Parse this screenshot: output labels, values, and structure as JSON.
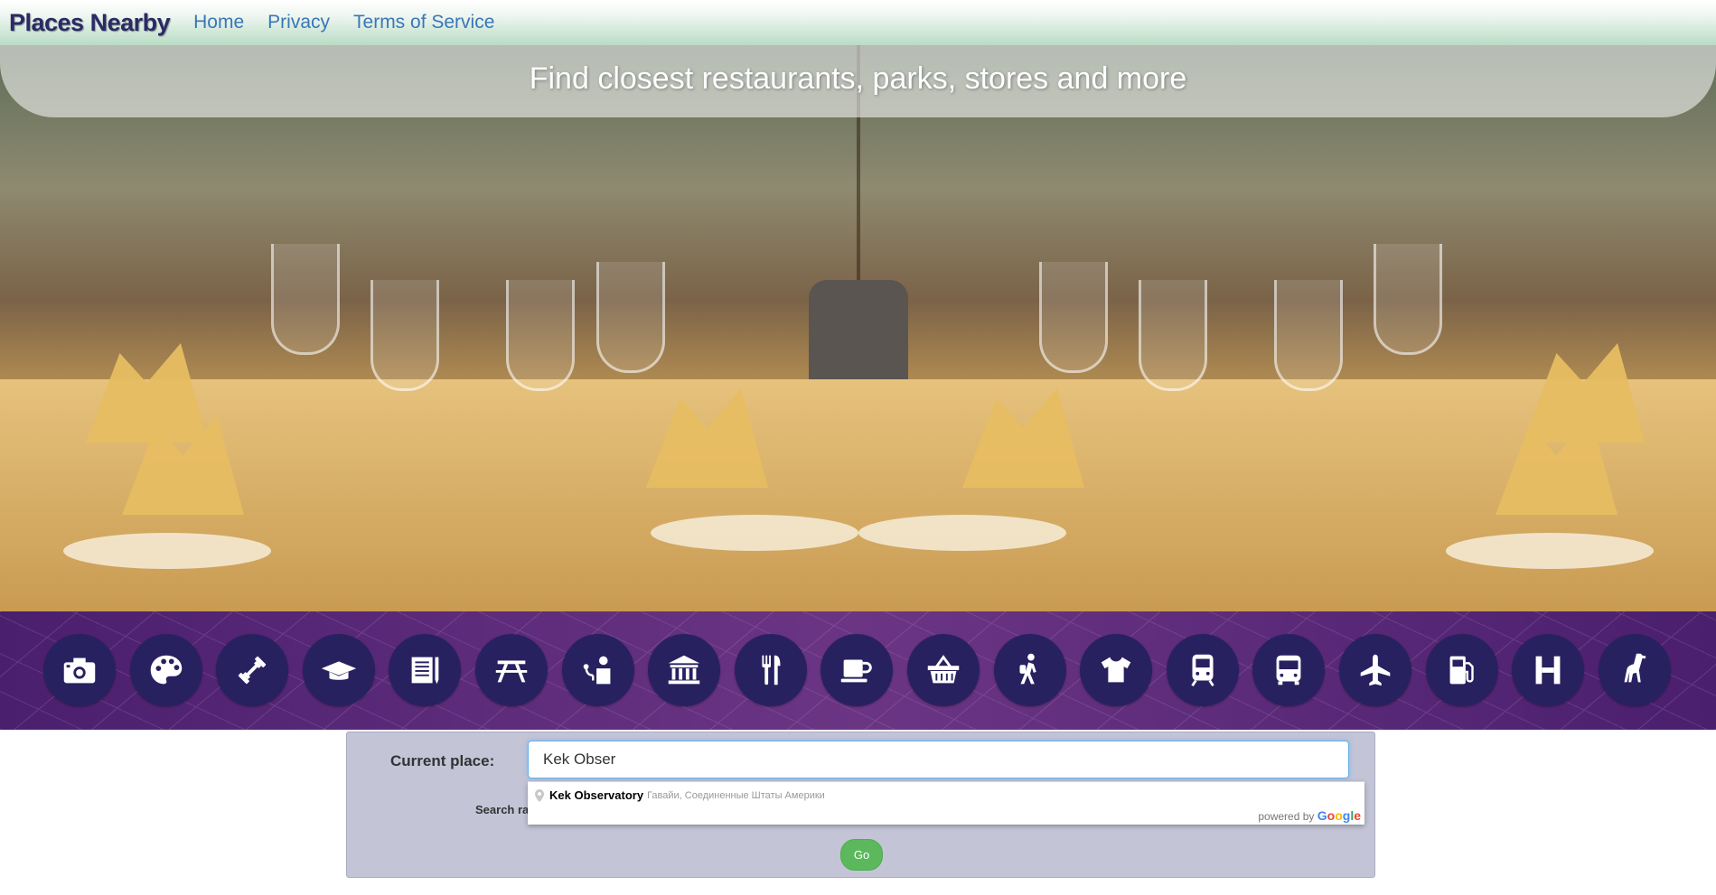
{
  "nav": {
    "brand": "Places Nearby",
    "links": [
      "Home",
      "Privacy",
      "Terms of Service"
    ]
  },
  "hero": {
    "tagline": "Find closest restaurants, parks, stores and more"
  },
  "categories": [
    {
      "icon": "camera-icon"
    },
    {
      "icon": "palette-icon"
    },
    {
      "icon": "dumbbell-icon"
    },
    {
      "icon": "graduation-cap-icon"
    },
    {
      "icon": "library-icon"
    },
    {
      "icon": "picnic-table-icon"
    },
    {
      "icon": "doctor-icon"
    },
    {
      "icon": "museum-icon"
    },
    {
      "icon": "restaurant-icon"
    },
    {
      "icon": "coffee-icon"
    },
    {
      "icon": "shopping-basket-icon"
    },
    {
      "icon": "hiking-icon"
    },
    {
      "icon": "clothing-icon"
    },
    {
      "icon": "train-icon"
    },
    {
      "icon": "bus-icon"
    },
    {
      "icon": "airplane-icon"
    },
    {
      "icon": "gas-station-icon"
    },
    {
      "icon": "hotel-icon"
    },
    {
      "icon": "zoo-icon"
    }
  ],
  "form": {
    "current_place_label": "Current place:",
    "current_place_value": "Kek Obser",
    "search_radius_label": "Search ra",
    "go_label": "Go"
  },
  "autocomplete": {
    "main": "Kek Observatory",
    "secondary": "Гавайи, Соединенные Штаты Америки",
    "powered_by": "powered by",
    "google": "Google"
  },
  "colors": {
    "accent": "#28215f",
    "icon_bar": "#5a2a7a",
    "go_button": "#5cb85c",
    "panel": "#c3c4d6",
    "link": "#3a76b8"
  }
}
